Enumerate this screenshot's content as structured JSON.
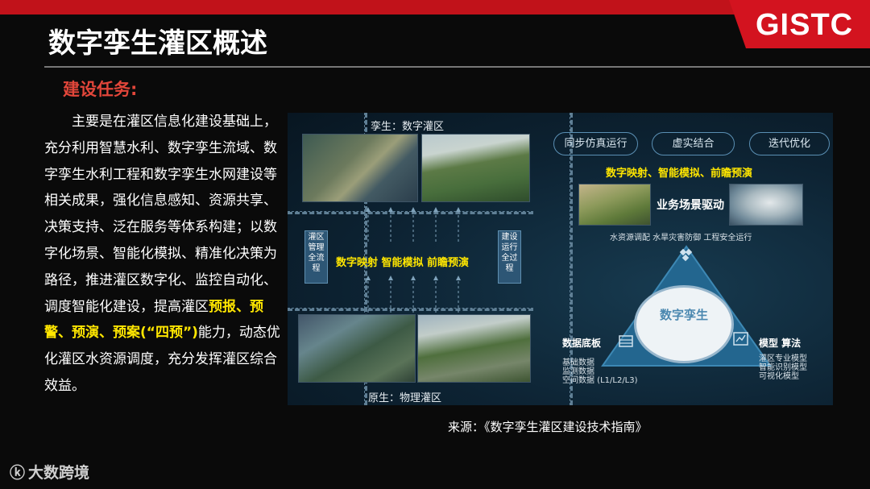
{
  "header": {
    "logo": "GISTC",
    "title": "数字孪生灌区概述"
  },
  "section": {
    "subtitle": "建设任务:",
    "para_part1": "主要是在灌区信息化建设基础上，充分利用智慧水利、数字孪生流域、数字孪生水利工程和数字孪生水网建设等相关成果，强化信息感知、资源共享、决策支持、泛在服务等体系构建；以数字化场景、智能化模拟、精准化决策为路径，推进灌区数字化、监控自动化、调度智能化建设，提高灌区",
    "para_highlight": "预报、预警、预演、预案(“四预”)",
    "para_part2": "能力，动态优化灌区水资源调度，充分发挥灌区综合效益。"
  },
  "diagram": {
    "twin_label": "孪生：数字灌区",
    "physical_label": "原生：物理灌区",
    "left_box": "灌区管理全流程",
    "right_box": "建设运行全过程",
    "middle_flow": "数字映射  智能模拟  前瞻预演",
    "pills": [
      "同步仿真运行",
      "虚实结合",
      "迭代优化"
    ],
    "right_flow": "数字映射、智能模拟、前瞻预演",
    "scenario_title": "业务场景驱动",
    "scenario_sub": "水资源调配  水旱灾害防御  工程安全运行",
    "center_label": "数字孪生",
    "data_base_title": "数据底板",
    "data_base_items": [
      "基础数据",
      "监测数据",
      "空间数据 (L1/L2/L3)"
    ],
    "model_title": "模型  算法",
    "model_items": [
      "灌区专业模型",
      "智能识别模型",
      "可视化模型"
    ]
  },
  "footer": {
    "source": "来源：《数字孪生灌区建设技术指南》",
    "brand": "大数跨境"
  }
}
